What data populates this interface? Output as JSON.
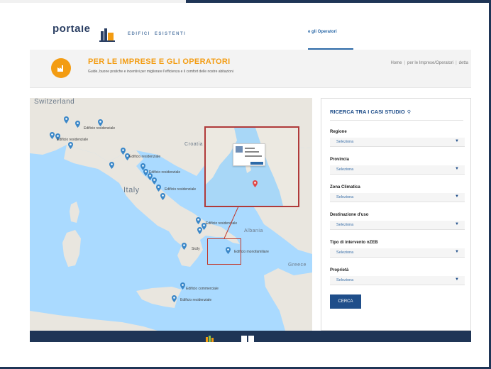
{
  "header": {
    "logo_text": "portale",
    "nav_items": [
      "EDIFICI",
      "ESISTENTI"
    ],
    "active_nav": "e gli Operatori"
  },
  "banner": {
    "title": "PER LE IMPRESE E GLI OPERATORI",
    "subtitle": "Guide, buone pratiche e incentivi per migliorare l'efficienza e il comfort delle nostre abitazioni",
    "breadcrumb": [
      "Home",
      "per le Imprese/Operatori",
      "detta"
    ]
  },
  "map": {
    "country_labels": {
      "switzerland": "Switzerland",
      "italy": "Italy",
      "croatia": "Croatia",
      "albania": "Albania",
      "greece": "Greece"
    },
    "pin_labels": [
      "Edificio residenziale",
      "Edificio residenziale",
      "Edificio residenziale",
      "Edificio residenziale",
      "Edificio residenziale",
      "Edificio residenziale",
      "Edificio monofamiliare",
      "Edificio commerciale",
      "Edificio residenziale"
    ],
    "city_label": "Sicily",
    "pin_color": "#3a87c8",
    "highlight_color": "#c0392b"
  },
  "search": {
    "title": "RICERCA TRA I CASI STUDIO",
    "fields": [
      {
        "label": "Regione",
        "value": "Seleziona"
      },
      {
        "label": "Provincia",
        "value": "Seleziona"
      },
      {
        "label": "Zona Climatica",
        "value": "Seleziona"
      },
      {
        "label": "Destinazione d'uso",
        "value": "Seleziona"
      },
      {
        "label": "Tipo di intervento nZEB",
        "value": "Seleziona"
      },
      {
        "label": "Proprietà",
        "value": "Seleziona"
      }
    ],
    "button_label": "CERCA"
  },
  "colors": {
    "accent": "#f39c12",
    "brand": "#1f4e8a",
    "footer": "#1f3556"
  }
}
